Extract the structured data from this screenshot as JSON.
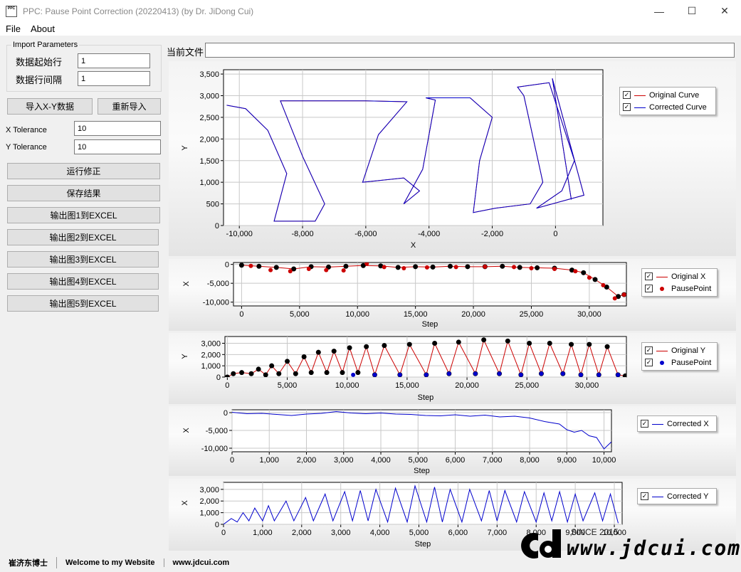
{
  "window": {
    "title": "PPC: Pause Point Correction (20220413) (by Dr. JiDong Cui)",
    "icon_text": "PPC",
    "min_glyph": "—",
    "max_glyph": "☐",
    "close_glyph": "✕"
  },
  "menu": [
    {
      "label": "File"
    },
    {
      "label": "About"
    }
  ],
  "import_group": {
    "title": "Import Parameters",
    "start_row_label": "数据起始行",
    "start_row_value": "1",
    "interval_label": "数据行间隔",
    "interval_value": "1"
  },
  "buttons": {
    "import_xy": "导入X-Y数据",
    "reimport": "重新导入",
    "run": "运行修正",
    "save": "保存结果",
    "export1": "输出图1到EXCEL",
    "export2": "输出图2到EXCEL",
    "export3": "输出图3到EXCEL",
    "export4": "输出图4到EXCEL",
    "export5": "输出图5到EXCEL"
  },
  "tolerance": {
    "x_label": "X Tolerance",
    "x_value": "10",
    "y_label": "Y Tolerance",
    "y_value": "10"
  },
  "current_file": {
    "label": "当前文件",
    "value": ""
  },
  "status": {
    "author": "崔济东博士",
    "welcome": "Welcome to my Website",
    "site": "www.jdcui.com"
  },
  "watermark": {
    "since": "SINCE 2015",
    "text": "www.jdcui.com",
    "logo": "Cd"
  },
  "colors": {
    "original": "#cc0000",
    "corrected": "#0000cc",
    "pause_x": "#cc0000",
    "pause_y": "#0000cc",
    "points": "#000000"
  },
  "chart_data": [
    {
      "type": "line",
      "xlabel": "X",
      "ylabel": "Y",
      "xlim": [
        -10500,
        1500
      ],
      "ylim": [
        0,
        3600
      ],
      "xticks": [
        -10000,
        -8000,
        -6000,
        -4000,
        -2000,
        0
      ],
      "xtick_labels": [
        "-10,000",
        "-8,000",
        "-6,000",
        "-4,000",
        "-2,000",
        "0"
      ],
      "yticks": [
        0,
        500,
        1000,
        1500,
        2000,
        2500,
        3000,
        3500
      ],
      "ytick_labels": [
        "0",
        "500",
        "1,000",
        "1,500",
        "2,000",
        "2,500",
        "3,000",
        "3,500"
      ],
      "series": [
        {
          "name": "Original Curve",
          "x": [
            -10400,
            -9800,
            -9100,
            -8500,
            -8900,
            -7600,
            -7300,
            -8000,
            -8700,
            -7200,
            -6000,
            -4700,
            -5600,
            -6100,
            -4800,
            -4300,
            -4800,
            -4200,
            -3800,
            -4100,
            -2700,
            -2000,
            -2400,
            -2600,
            -1900,
            -800,
            -400,
            -1000,
            -1200,
            -200,
            600,
            200,
            -600,
            900,
            -100,
            500
          ],
          "y": [
            2780,
            2700,
            2200,
            1200,
            100,
            100,
            500,
            1600,
            2880,
            2880,
            2880,
            2860,
            2100,
            1000,
            1100,
            800,
            500,
            1300,
            2900,
            2950,
            2950,
            2500,
            1500,
            300,
            400,
            500,
            1000,
            3000,
            3200,
            3300,
            1500,
            800,
            400,
            700,
            3400,
            600
          ]
        },
        {
          "name": "Corrected Curve",
          "x": [
            -10400,
            -9800,
            -9100,
            -8500,
            -8900,
            -7600,
            -7300,
            -8000,
            -8700,
            -7200,
            -6000,
            -4700,
            -5600,
            -6100,
            -4800,
            -4300,
            -4800,
            -4200,
            -3800,
            -4100,
            -2700,
            -2000,
            -2400,
            -2600,
            -1900,
            -800,
            -400,
            -1000,
            -1200,
            -200,
            600,
            200,
            -600,
            900,
            -100,
            500
          ],
          "y": [
            2780,
            2700,
            2200,
            1200,
            100,
            100,
            500,
            1600,
            2880,
            2880,
            2880,
            2860,
            2100,
            1000,
            1100,
            800,
            500,
            1300,
            2900,
            2950,
            2950,
            2500,
            1500,
            300,
            400,
            500,
            1000,
            3000,
            3200,
            3300,
            1500,
            800,
            400,
            700,
            3400,
            600
          ]
        }
      ]
    },
    {
      "type": "scatter",
      "xlabel": "Step",
      "ylabel": "X",
      "xlim": [
        -700,
        33200
      ],
      "ylim": [
        -11000,
        500
      ],
      "xticks": [
        0,
        5000,
        10000,
        15000,
        20000,
        25000,
        30000
      ],
      "xtick_labels": [
        "0",
        "5,000",
        "10,000",
        "15,000",
        "20,000",
        "25,000",
        "30,000"
      ],
      "yticks": [
        0,
        -5000,
        -10000
      ],
      "ytick_labels": [
        "0",
        "-5,000",
        "-10,000"
      ],
      "series": [
        {
          "name": "Original X",
          "x": [
            0,
            1500,
            3000,
            4500,
            6000,
            7500,
            9000,
            10500,
            12000,
            13500,
            15000,
            16500,
            18000,
            19500,
            21000,
            22500,
            24000,
            25500,
            27000,
            28500,
            29500,
            30500,
            31500,
            32500,
            33000
          ],
          "y": [
            -200,
            -500,
            -800,
            -1200,
            -600,
            -700,
            -500,
            -300,
            -400,
            -800,
            -600,
            -700,
            -500,
            -600,
            -600,
            -500,
            -800,
            -900,
            -1000,
            -1500,
            -2200,
            -4000,
            -6000,
            -8500,
            -8000
          ]
        },
        {
          "name": "PausePoint",
          "x": [
            800,
            2500,
            4200,
            5800,
            7300,
            8800,
            10800,
            12300,
            14000,
            16000,
            18500,
            21000,
            23500,
            25000,
            27000,
            28800,
            30000,
            31200,
            32200,
            33000
          ],
          "y": [
            -400,
            -1500,
            -1800,
            -1200,
            -1500,
            -1600,
            200,
            -700,
            -1000,
            -800,
            -700,
            -600,
            -700,
            -1000,
            -1200,
            -1800,
            -3500,
            -5500,
            -9000,
            -8000
          ]
        }
      ]
    },
    {
      "type": "scatter",
      "xlabel": "Step",
      "ylabel": "Y",
      "xlim": [
        -200,
        33300
      ],
      "ylim": [
        0,
        3600
      ],
      "xticks": [
        0,
        5000,
        10000,
        15000,
        20000,
        25000,
        30000
      ],
      "xtick_labels": [
        "0",
        "5,000",
        "10,000",
        "15,000",
        "20,000",
        "25,000",
        "30,000"
      ],
      "yticks": [
        0,
        1000,
        2000,
        3000
      ],
      "ytick_labels": [
        "0",
        "1,000",
        "2,000",
        "3,000"
      ],
      "series": [
        {
          "name": "Original Y",
          "x": [
            0,
            500,
            1200,
            2000,
            2600,
            3200,
            3700,
            4300,
            5000,
            5700,
            6400,
            7000,
            7600,
            8300,
            8900,
            9600,
            10200,
            10900,
            11600,
            12300,
            13100,
            14400,
            15200,
            16600,
            17300,
            18500,
            19300,
            20700,
            21400,
            22700,
            23400,
            24500,
            25200,
            26200,
            26900,
            28000,
            28700,
            29500,
            30200,
            31000,
            31700,
            32600,
            33200
          ],
          "y": [
            0,
            300,
            400,
            300,
            700,
            200,
            1000,
            300,
            1400,
            300,
            1800,
            400,
            2200,
            400,
            2300,
            400,
            2600,
            400,
            2700,
            200,
            2800,
            200,
            2900,
            200,
            3000,
            300,
            3100,
            300,
            3300,
            300,
            3200,
            200,
            3000,
            300,
            3000,
            300,
            2900,
            200,
            2900,
            200,
            2700,
            200,
            100
          ]
        },
        {
          "name": "PausePoint",
          "x": [
            10500,
            12300,
            14400,
            16600,
            18500,
            20700,
            22700,
            24500,
            26200,
            28000,
            29500,
            31000,
            32600
          ],
          "y": [
            200,
            200,
            200,
            200,
            300,
            300,
            300,
            200,
            300,
            300,
            200,
            200,
            200
          ]
        }
      ]
    },
    {
      "type": "line",
      "xlabel": "Step",
      "ylabel": "X",
      "xlim": [
        0,
        10200
      ],
      "ylim": [
        -11000,
        800
      ],
      "xticks": [
        0,
        1000,
        2000,
        3000,
        4000,
        5000,
        6000,
        7000,
        8000,
        9000,
        10000
      ],
      "xtick_labels": [
        "0",
        "1,000",
        "2,000",
        "3,000",
        "4,000",
        "5,000",
        "6,000",
        "7,000",
        "8,000",
        "9,000",
        "10,000"
      ],
      "yticks": [
        0,
        -5000,
        -10000
      ],
      "ytick_labels": [
        "0",
        "-5,000",
        "-10,000"
      ],
      "series": [
        {
          "name": "Corrected X",
          "x": [
            0,
            400,
            800,
            1200,
            1600,
            2000,
            2400,
            2800,
            3200,
            3600,
            4000,
            4400,
            4800,
            5200,
            5600,
            6000,
            6400,
            6800,
            7200,
            7600,
            8000,
            8400,
            8800,
            9000,
            9200,
            9400,
            9600,
            9800,
            10000,
            10200
          ],
          "y": [
            100,
            -300,
            -200,
            -500,
            -800,
            -400,
            -200,
            300,
            -100,
            -300,
            -100,
            -400,
            -500,
            -800,
            -900,
            -600,
            -1000,
            -700,
            -1200,
            -1000,
            -1500,
            -2500,
            -3200,
            -4800,
            -5500,
            -5000,
            -6500,
            -7000,
            -10200,
            -8200
          ]
        }
      ]
    },
    {
      "type": "line",
      "xlabel": "Step",
      "ylabel": "X",
      "xlim": [
        0,
        10200
      ],
      "ylim": [
        0,
        3600
      ],
      "xticks": [
        0,
        1000,
        2000,
        3000,
        4000,
        5000,
        6000,
        7000,
        8000,
        9000,
        10000
      ],
      "xtick_labels": [
        "0",
        "1,000",
        "2,000",
        "3,000",
        "4,000",
        "5,000",
        "6,000",
        "7,000",
        "8,000",
        "9,000",
        "10,000"
      ],
      "yticks": [
        0,
        1000,
        2000,
        3000
      ],
      "ytick_labels": [
        "0",
        "1,000",
        "2,000",
        "3,000"
      ],
      "series": [
        {
          "name": "Corrected Y",
          "x": [
            0,
            200,
            350,
            500,
            650,
            800,
            1000,
            1150,
            1300,
            1600,
            1800,
            2100,
            2300,
            2600,
            2800,
            3100,
            3300,
            3500,
            3700,
            3900,
            4200,
            4400,
            4700,
            4900,
            5200,
            5400,
            5600,
            5800,
            6100,
            6300,
            6600,
            6800,
            7000,
            7200,
            7500,
            7700,
            8000,
            8200,
            8400,
            8600,
            8800,
            9000,
            9200,
            9500,
            9700,
            9900,
            10100
          ],
          "y": [
            0,
            500,
            200,
            1000,
            300,
            1400,
            300,
            1600,
            300,
            2000,
            300,
            2300,
            300,
            2600,
            300,
            2800,
            300,
            2900,
            300,
            3000,
            200,
            3100,
            200,
            3300,
            200,
            3200,
            200,
            3000,
            200,
            3000,
            300,
            2900,
            300,
            2900,
            200,
            2800,
            200,
            2700,
            300,
            2800,
            200,
            2600,
            300,
            2700,
            300,
            2600,
            100
          ]
        }
      ]
    }
  ]
}
